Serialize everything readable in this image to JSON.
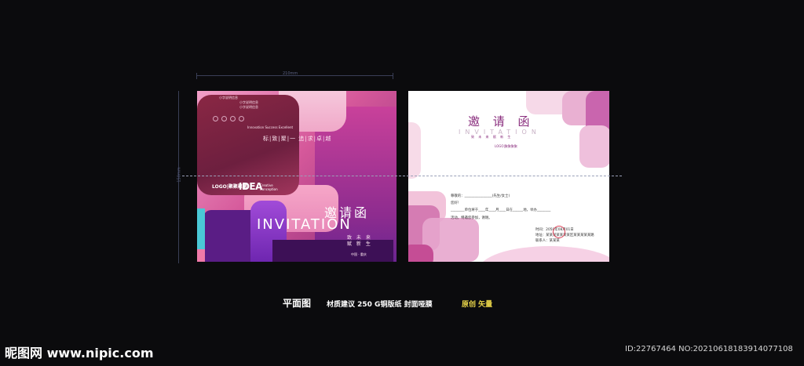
{
  "colors": {
    "background": "#0b0b0d",
    "accent_purple": "#8a2e7e",
    "caption_yellow": "#e9d54a"
  },
  "guides": {
    "width_label": "210mm",
    "height_label": "150mm"
  },
  "cover": {
    "small_top_lines": [
      "小字说明信息",
      "小字说明信息",
      "小字说明信息"
    ],
    "slogan_en": "Innovation Success Excellent",
    "slogan_cn": "标|致|聚|一  追|求|卓|越",
    "logo": "LOGO|聚聚聚聚",
    "idea": "IDEA",
    "idea_sub": "Creative\nConception",
    "title_cn": "邀请函",
    "title_en": "INVITATION",
    "sub1": "致 未 来",
    "sub2": "赋 新 生",
    "place": "中国 · 重庆"
  },
  "inside": {
    "title_cn": "邀 请 函",
    "title_en": "INVITATION",
    "sub": "致 未 来    赋 新 生",
    "logo": "LOGO|聚聚聚聚",
    "lines": [
      "尊敬的：________________(先生/女士)",
      "您好！",
      "________单位将于____年____月____日在______地，举办________",
      "活动，特邀您参加，谢谢。",
      "时间：2050年08月01日",
      "地址：某某某某某某某区某某某某某路",
      "联系人：某某某"
    ]
  },
  "captions": {
    "main": "平面图",
    "spec": "材质建议 250 G铜版纸 封面哑膜",
    "yellow": "原创  矢量"
  },
  "watermark": {
    "site": "昵图网 www.nipic.com",
    "id": "ID:22767464 NO:20210618183914077108"
  }
}
